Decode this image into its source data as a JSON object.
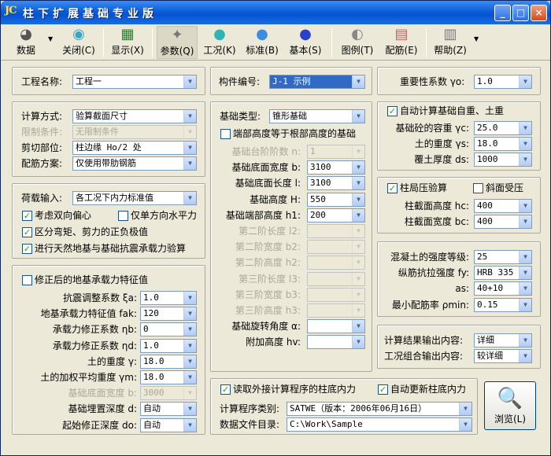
{
  "window": {
    "logo": "JC",
    "title": "柱下扩展基础专业版",
    "min": "_",
    "max": "□",
    "close": "×"
  },
  "toolbar": [
    {
      "label": "数据",
      "icon": "◕"
    },
    {
      "label": "关闭(C)",
      "icon": "◉"
    },
    {
      "label": "显示(X)",
      "icon": "▦"
    },
    {
      "label": "参数(Q)",
      "icon": "✦"
    },
    {
      "label": "工况(K)",
      "icon": "●"
    },
    {
      "label": "标准(B)",
      "icon": "●"
    },
    {
      "label": "基本(S)",
      "icon": "●"
    },
    {
      "label": "图例(T)",
      "icon": "◐"
    },
    {
      "label": "配筋(E)",
      "icon": "▤"
    },
    {
      "label": "帮助(Z)",
      "icon": "▥"
    }
  ],
  "top": {
    "proj_label": "工程名称:",
    "proj_val": "工程一",
    "comp_label": "构件编号:",
    "comp_val": "J-1 示例",
    "imp_label": "重要性系数 γo:",
    "imp_val": "1.0"
  },
  "calc": {
    "method_label": "计算方式:",
    "method_val": "验算截面尺寸",
    "limit_label": "限制条件:",
    "limit_val": "无限制条件",
    "shear_label": "剪切部位:",
    "shear_val": "柱边缘 Ho/2 处",
    "rebar_label": "配筋方案:",
    "rebar_val": "仅使用带肋钢筋"
  },
  "load": {
    "input_label": "荷载输入:",
    "input_val": "各工况下内力标准值",
    "cb1": "考虑双向偏心",
    "cb2": "仅单方向水平力",
    "cb3": "区分弯矩、剪力的正负极值",
    "cb4": "进行天然地基与基础抗震承载力验算"
  },
  "soil": {
    "title": "修正后的地基承载力特征值",
    "rows": [
      {
        "label": "抗震调整系数 ξa:",
        "val": "1.0",
        "dis": false
      },
      {
        "label": "地基承载力特征值 fak:",
        "val": "120",
        "dis": false
      },
      {
        "label": "承载力修正系数 ηb:",
        "val": "0",
        "dis": false
      },
      {
        "label": "承载力修正系数 ηd:",
        "val": "1.0",
        "dis": false
      },
      {
        "label": "土的重度 γ:",
        "val": "18.0",
        "dis": false
      },
      {
        "label": "土的加权平均重度 γm:",
        "val": "18.0",
        "dis": false
      },
      {
        "label": "基础底面宽度 b:",
        "val": "3000",
        "dis": true
      },
      {
        "label": "基础埋置深度 d:",
        "val": "自动",
        "dis": false
      },
      {
        "label": "起始修正深度 do:",
        "val": "自动",
        "dis": false
      }
    ]
  },
  "found": {
    "type_label": "基础类型:",
    "type_val": "锥形基础",
    "cb_end": "端部高度等于根部高度的基础",
    "rows": [
      {
        "label": "基础台阶阶数 n:",
        "val": "1",
        "dis": true
      },
      {
        "label": "基础底面宽度 b:",
        "val": "3100",
        "dis": false
      },
      {
        "label": "基础底面长度 l:",
        "val": "3100",
        "dis": false
      },
      {
        "label": "基础高度 H:",
        "val": "550",
        "dis": false
      },
      {
        "label": "基础端部高度 h1:",
        "val": "200",
        "dis": false
      },
      {
        "label": "第二阶长度 l2:",
        "val": "",
        "dis": true
      },
      {
        "label": "第二阶宽度 b2:",
        "val": "",
        "dis": true
      },
      {
        "label": "第二阶高度 h2:",
        "val": "",
        "dis": true
      },
      {
        "label": "第三阶长度 l3:",
        "val": "",
        "dis": true
      },
      {
        "label": "第三阶宽度 b3:",
        "val": "",
        "dis": true
      },
      {
        "label": "第三阶高度 h3:",
        "val": "",
        "dis": true
      },
      {
        "label": "基础旋转角度 α:",
        "val": "",
        "dis": false
      },
      {
        "label": "附加高度 hv:",
        "val": "",
        "dis": false
      }
    ]
  },
  "weight": {
    "cb": "自动计算基础自重、土重",
    "rows": [
      {
        "label": "基础砼的容重 γc:",
        "val": "25.0"
      },
      {
        "label": "土的重度 γs:",
        "val": "18.0"
      },
      {
        "label": "覆土厚度 ds:",
        "val": "1000"
      }
    ]
  },
  "local": {
    "cb1": "柱局压验算",
    "cb2": "斜面受压",
    "rows": [
      {
        "label": "柱截面高度 hc:",
        "val": "400"
      },
      {
        "label": "柱截面宽度 bc:",
        "val": "400"
      }
    ]
  },
  "mat": {
    "rows": [
      {
        "label": "混凝土的强度等级:",
        "val": "25"
      },
      {
        "label": "纵筋抗拉强度 fy:",
        "val": "HRB 335"
      },
      {
        "label": "as:",
        "val": "40+10"
      },
      {
        "label": "最小配筋率 ρmin:",
        "val": "0.15"
      }
    ]
  },
  "output": {
    "r1_label": "计算结果输出内容:",
    "r1_val": "详细",
    "r2_label": "工况组合输出内容:",
    "r2_val": "较详细"
  },
  "ext": {
    "cb1": "读取外接计算程序的柱底内力",
    "cb2": "自动更新柱底内力",
    "prog_label": "计算程序类别:",
    "prog_val": "SATWE（版本：2006年06月16日）",
    "dir_label": "数据文件目录:",
    "dir_val": "C:\\Work\\Sample"
  },
  "browse": {
    "label": "浏览(L)",
    "icon": "🔍"
  }
}
